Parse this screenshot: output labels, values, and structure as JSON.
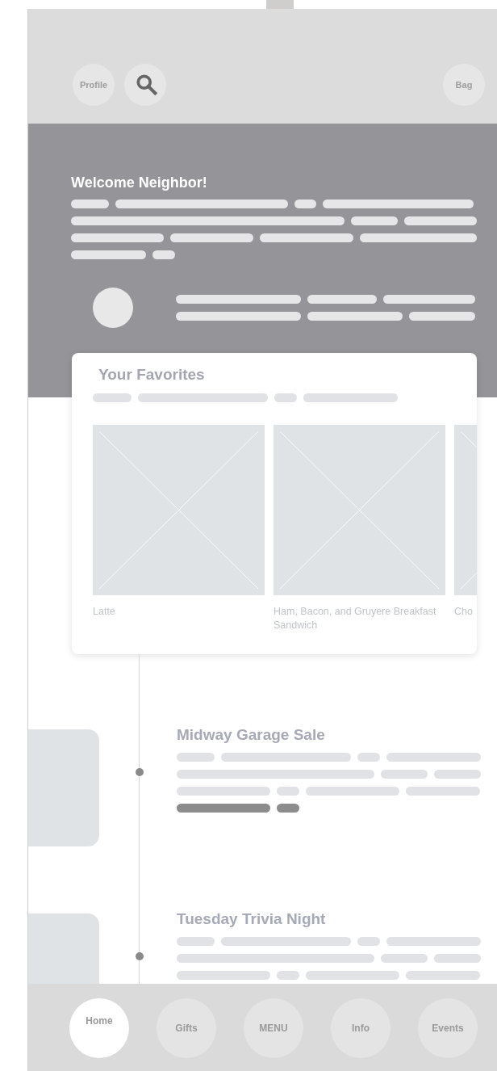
{
  "header": {
    "left": [
      {
        "kind": "text",
        "label": "Profile"
      },
      {
        "kind": "search"
      }
    ],
    "right": [
      {
        "kind": "text",
        "label": "Bag"
      }
    ]
  },
  "hero": {
    "title": "Welcome Neighbor!"
  },
  "favorites": {
    "title": "Your Favorites",
    "items": [
      {
        "label": "Latte"
      },
      {
        "label": "Ham, Bacon, and Gruyere Breakfast Sandwich"
      },
      {
        "label": "Cho"
      }
    ]
  },
  "events": [
    {
      "title": "Midway Garage Sale"
    },
    {
      "title": "Tuesday Trivia Night"
    }
  ],
  "nav": [
    {
      "label": "Home",
      "selected": true
    },
    {
      "label": "Gifts",
      "selected": false
    },
    {
      "label": "MENU",
      "selected": false
    },
    {
      "label": "Info",
      "selected": false
    },
    {
      "label": "Events",
      "selected": false
    }
  ]
}
